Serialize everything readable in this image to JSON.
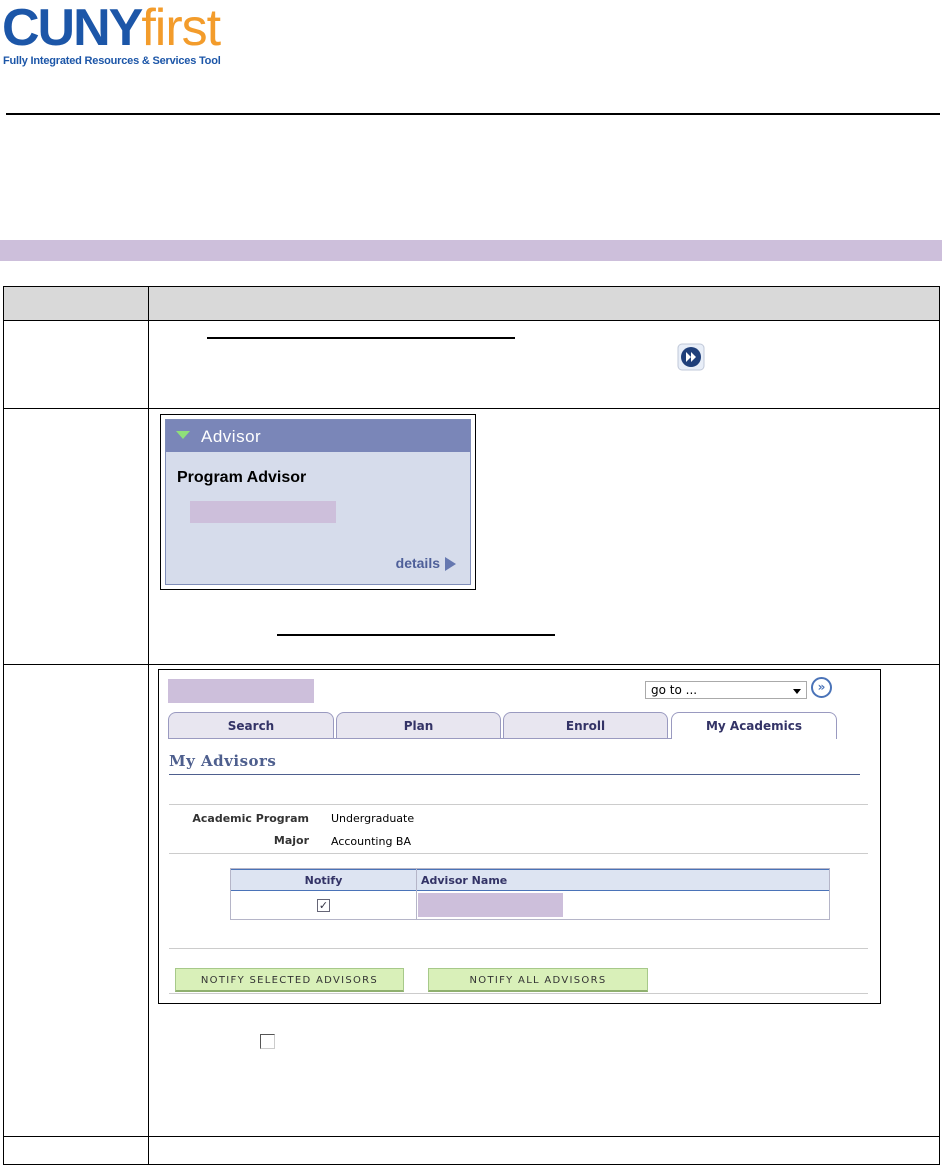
{
  "header": {
    "logo_cuny": "CUNY",
    "logo_first": "first",
    "logo_tagline": "Fully Integrated Resources & Services Tool"
  },
  "advisor_widget": {
    "title": "Advisor",
    "program_advisor_label": "Program Advisor",
    "details_link": "details"
  },
  "academics_screen": {
    "goto_select": "go to ...",
    "tabs": [
      "Search",
      "Plan",
      "Enroll",
      "My Academics"
    ],
    "active_tab": "My Academics",
    "page_title": "My Advisors",
    "academic_program_label": "Academic Program",
    "academic_program_value": "Undergraduate",
    "major_label": "Major",
    "major_value": "Accounting BA",
    "table_headers": {
      "notify": "Notify",
      "advisor_name": "Advisor Name"
    },
    "notify_checked": true,
    "buttons": {
      "notify_selected": "NOTIFY SELECTED ADVISORS",
      "notify_all": "NOTIFY ALL ADVISORS"
    }
  },
  "colors": {
    "band": "#cdbfdb",
    "advisor_header": "#7a86b8",
    "button_green": "#d9f0b9"
  }
}
